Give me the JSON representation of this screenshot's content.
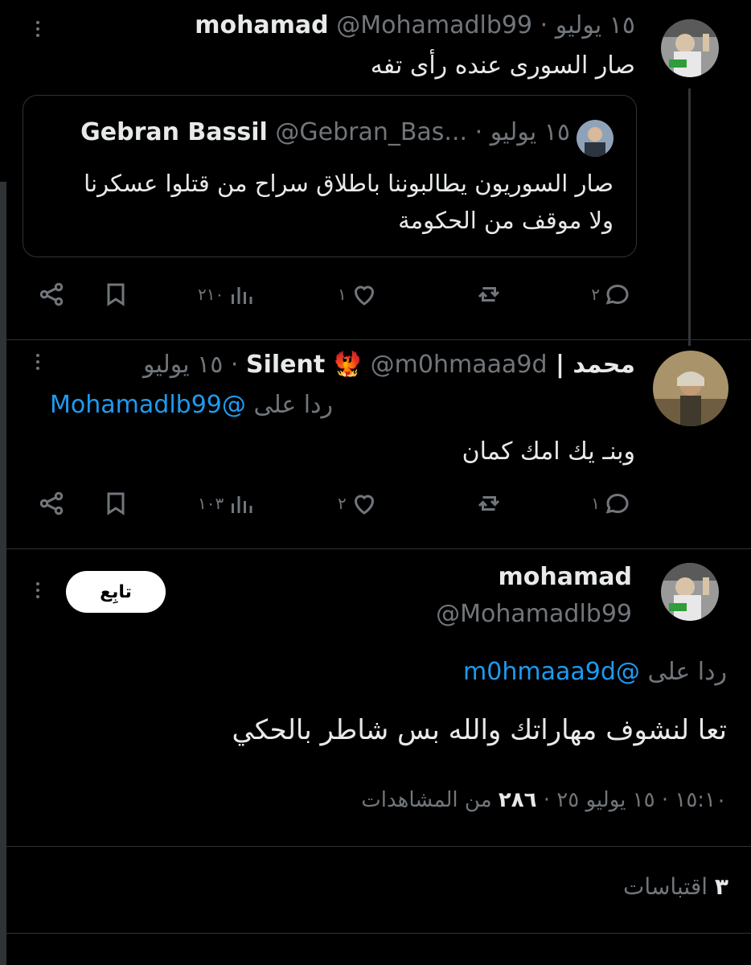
{
  "tweet1": {
    "name": "mohamad",
    "handle": "@Mohamadlb99",
    "date": "١٥ يوليو",
    "dot": "·",
    "text": "صار السورى عنده رأى تفه",
    "quote": {
      "name": "Gebran Bassil",
      "handle": "@Gebran_Bas...",
      "date": "١٥ يوليو",
      "dot": "·",
      "text_line1": "صار السوريون يطالبوننا باطلاق سراح من قتلوا عسكرنا",
      "text_line2": "ولا موقف من الحكومة"
    },
    "actions": {
      "replies": "٢",
      "likes": "١",
      "views": "٢١٠"
    }
  },
  "tweet2": {
    "name": "محمد | Silent",
    "badge_emoji": "🐦‍🔥",
    "handle": "@m0hmaaa9d",
    "date": "١٥ يوليو",
    "dot": "·",
    "reply_prefix": "ردا على",
    "reply_to": "@Mohamadlb99",
    "text": "وبنـ يك امك كمان",
    "actions": {
      "replies": "١",
      "likes": "٢",
      "views": "١٠٣"
    }
  },
  "tweet3": {
    "name": "mohamad",
    "handle": "@Mohamadlb99",
    "follow_label": "تابِع",
    "reply_prefix": "ردا على",
    "reply_to": "@m0hmaaa9d",
    "text": "تعا لنشوف مهاراتك والله بس شاطر بالحكي",
    "meta_time": "١٥:١٠",
    "meta_date": "١٥ يوليو ٢٥",
    "meta_views": "٢٨٦",
    "meta_views_label": "من المشاهدات",
    "dot": "·"
  },
  "quotes_count": "٣",
  "quotes_label": "اقتباسات",
  "colors": {
    "accent": "#1d9bf0",
    "muted": "#71767b",
    "bg": "#000000",
    "border": "#2f3336"
  }
}
